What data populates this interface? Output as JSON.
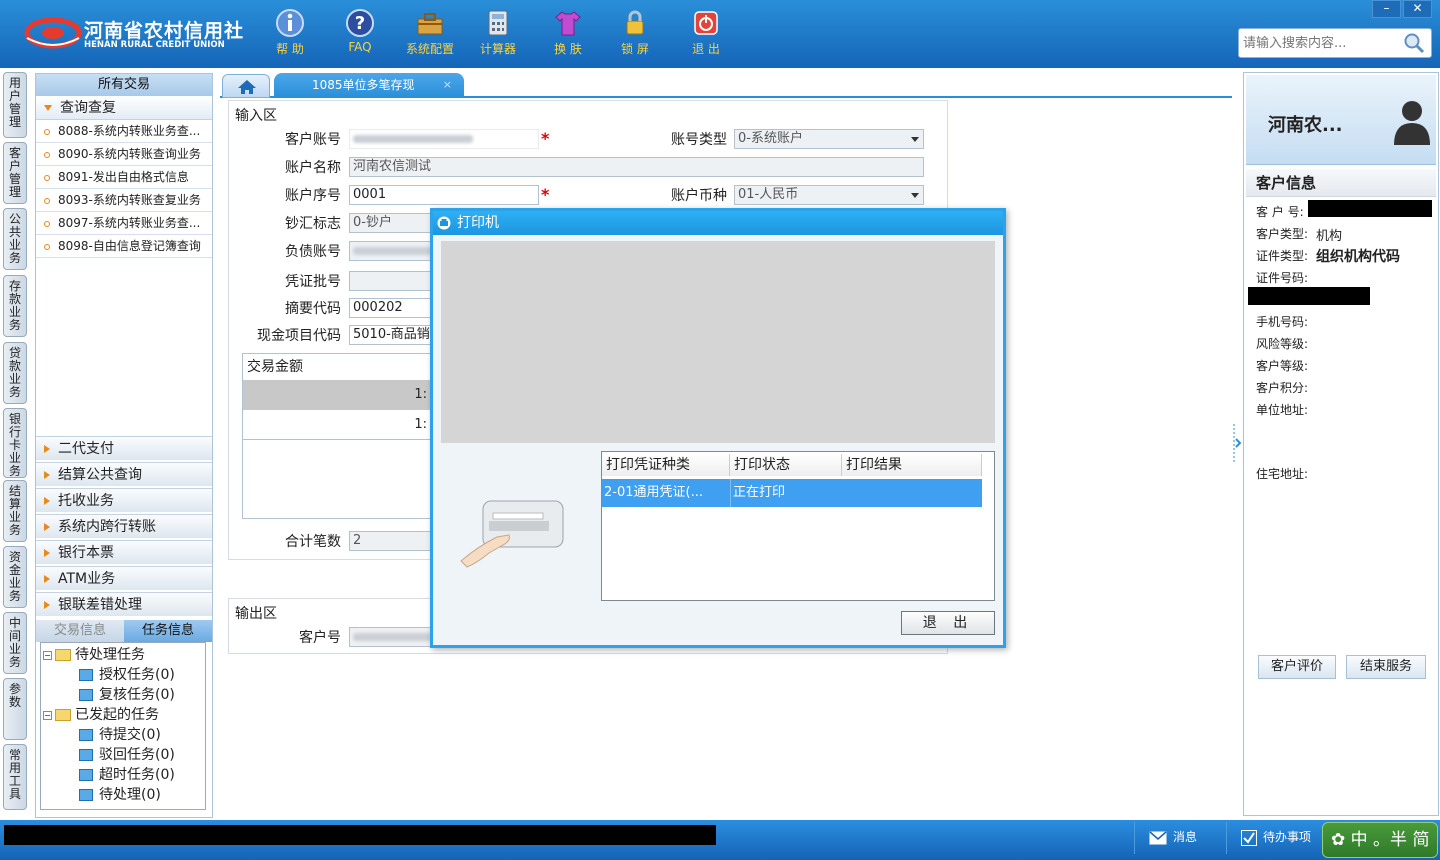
{
  "header": {
    "logo_cn": "河南省农村信用社",
    "logo_en": "HENAN RURAL CREDIT UNION",
    "toolbar": [
      {
        "label": "帮 助",
        "icon": "info-icon"
      },
      {
        "label": "FAQ",
        "icon": "question-icon"
      },
      {
        "label": "系统配置",
        "icon": "toolbox-icon"
      },
      {
        "label": "计算器",
        "icon": "calculator-icon"
      },
      {
        "label": "换 肤",
        "icon": "shirt-icon"
      },
      {
        "label": "锁 屏",
        "icon": "lock-icon"
      },
      {
        "label": "退 出",
        "icon": "power-icon"
      }
    ],
    "window_buttons": {
      "minimize": "–",
      "close": "✕"
    },
    "search_placeholder": "请输入搜索内容..."
  },
  "vertical_tabs": [
    "用户管理",
    "客户管理",
    "公共业务",
    "存款业务",
    "贷款业务",
    "银行卡业务",
    "结算业务",
    "资金业务",
    "中间业务",
    "参数",
    "常用工具"
  ],
  "left_nav": {
    "header": "所有交易",
    "category": "查询查复",
    "transactions": [
      "8088-系统内转账业务查...",
      "8090-系统内转账查询业务",
      "8091-发出自由格式信息",
      "8093-系统内转账查复业务",
      "8097-系统内转账业务查...",
      "8098-自由信息登记簿查询"
    ],
    "sections": [
      "二代支付",
      "结算公共查询",
      "托收业务",
      "系统内跨行转账",
      "银行本票",
      "ATM业务",
      "银联差错处理"
    ],
    "task_tabs": [
      "交易信息",
      "任务信息"
    ],
    "tree": {
      "pending": "待处理任务",
      "pending_items": [
        "授权任务(0)",
        "复核任务(0)"
      ],
      "initiated": "已发起的任务",
      "initiated_items": [
        "待提交(0)",
        "驳回任务(0)",
        "超时任务(0)",
        "待处理(0)"
      ]
    }
  },
  "tabs": {
    "active": "1085单位多笔存现",
    "close": "×"
  },
  "form": {
    "input_legend": "输入区",
    "labels": {
      "customer_account": "客户账号",
      "account_type": "账号类型",
      "account_name": "账户名称",
      "account_seq": "账户序号",
      "currency": "账户币种",
      "cash_flag": "钞汇标志",
      "liability_account": "负债账号",
      "voucher_batch": "凭证批号",
      "summary_code": "摘要代码",
      "cash_item_code": "现金项目代码",
      "total_count": "合计笔数"
    },
    "values": {
      "account_type": "0-系统账户",
      "account_name": "河南农信测试",
      "account_seq": "0001",
      "currency": "01-人民币",
      "cash_flag": "0-钞户",
      "summary_code": "000202",
      "cash_item_code": "5010-商品销",
      "total_count": "2"
    },
    "required_mark": "*",
    "amount_header": "交易金额",
    "amount_rows": [
      "1:",
      "1:"
    ],
    "output_legend": "输出区",
    "output_customer_label": "客户号"
  },
  "right_panel": {
    "name": "河南农...",
    "section_title": "客户信息",
    "fields": [
      {
        "label": "客 户 号:",
        "value": ""
      },
      {
        "label": "客户类型:",
        "value": "机构"
      },
      {
        "label": "证件类型:",
        "value": "组织机构代码"
      },
      {
        "label": "证件号码:",
        "value": ""
      },
      {
        "label": "手机号码:",
        "value": ""
      },
      {
        "label": "风险等级:",
        "value": ""
      },
      {
        "label": "客户等级:",
        "value": ""
      },
      {
        "label": "客户积分:",
        "value": ""
      },
      {
        "label": "单位地址:",
        "value": ""
      },
      {
        "label": "住宅地址:",
        "value": ""
      }
    ],
    "buttons": [
      "客户评价",
      "结束服务"
    ]
  },
  "dialog": {
    "title": "打印机",
    "columns": [
      "打印凭证种类",
      "打印状态",
      "打印结果"
    ],
    "row": {
      "type": "2-01通用凭证(...",
      "status": "正在打印",
      "result": ""
    },
    "exit_button": "退 出"
  },
  "status_bar": {
    "messages": "消息",
    "todo": "待办事项",
    "ime": "中 。半 简"
  },
  "colors": {
    "header_blue": "#1a75c8",
    "dialog_border": "#2aa3ea",
    "selected_row": "#3f9ff0",
    "required_red": "#dd0000",
    "toolbar_text": "#ffd23a"
  }
}
